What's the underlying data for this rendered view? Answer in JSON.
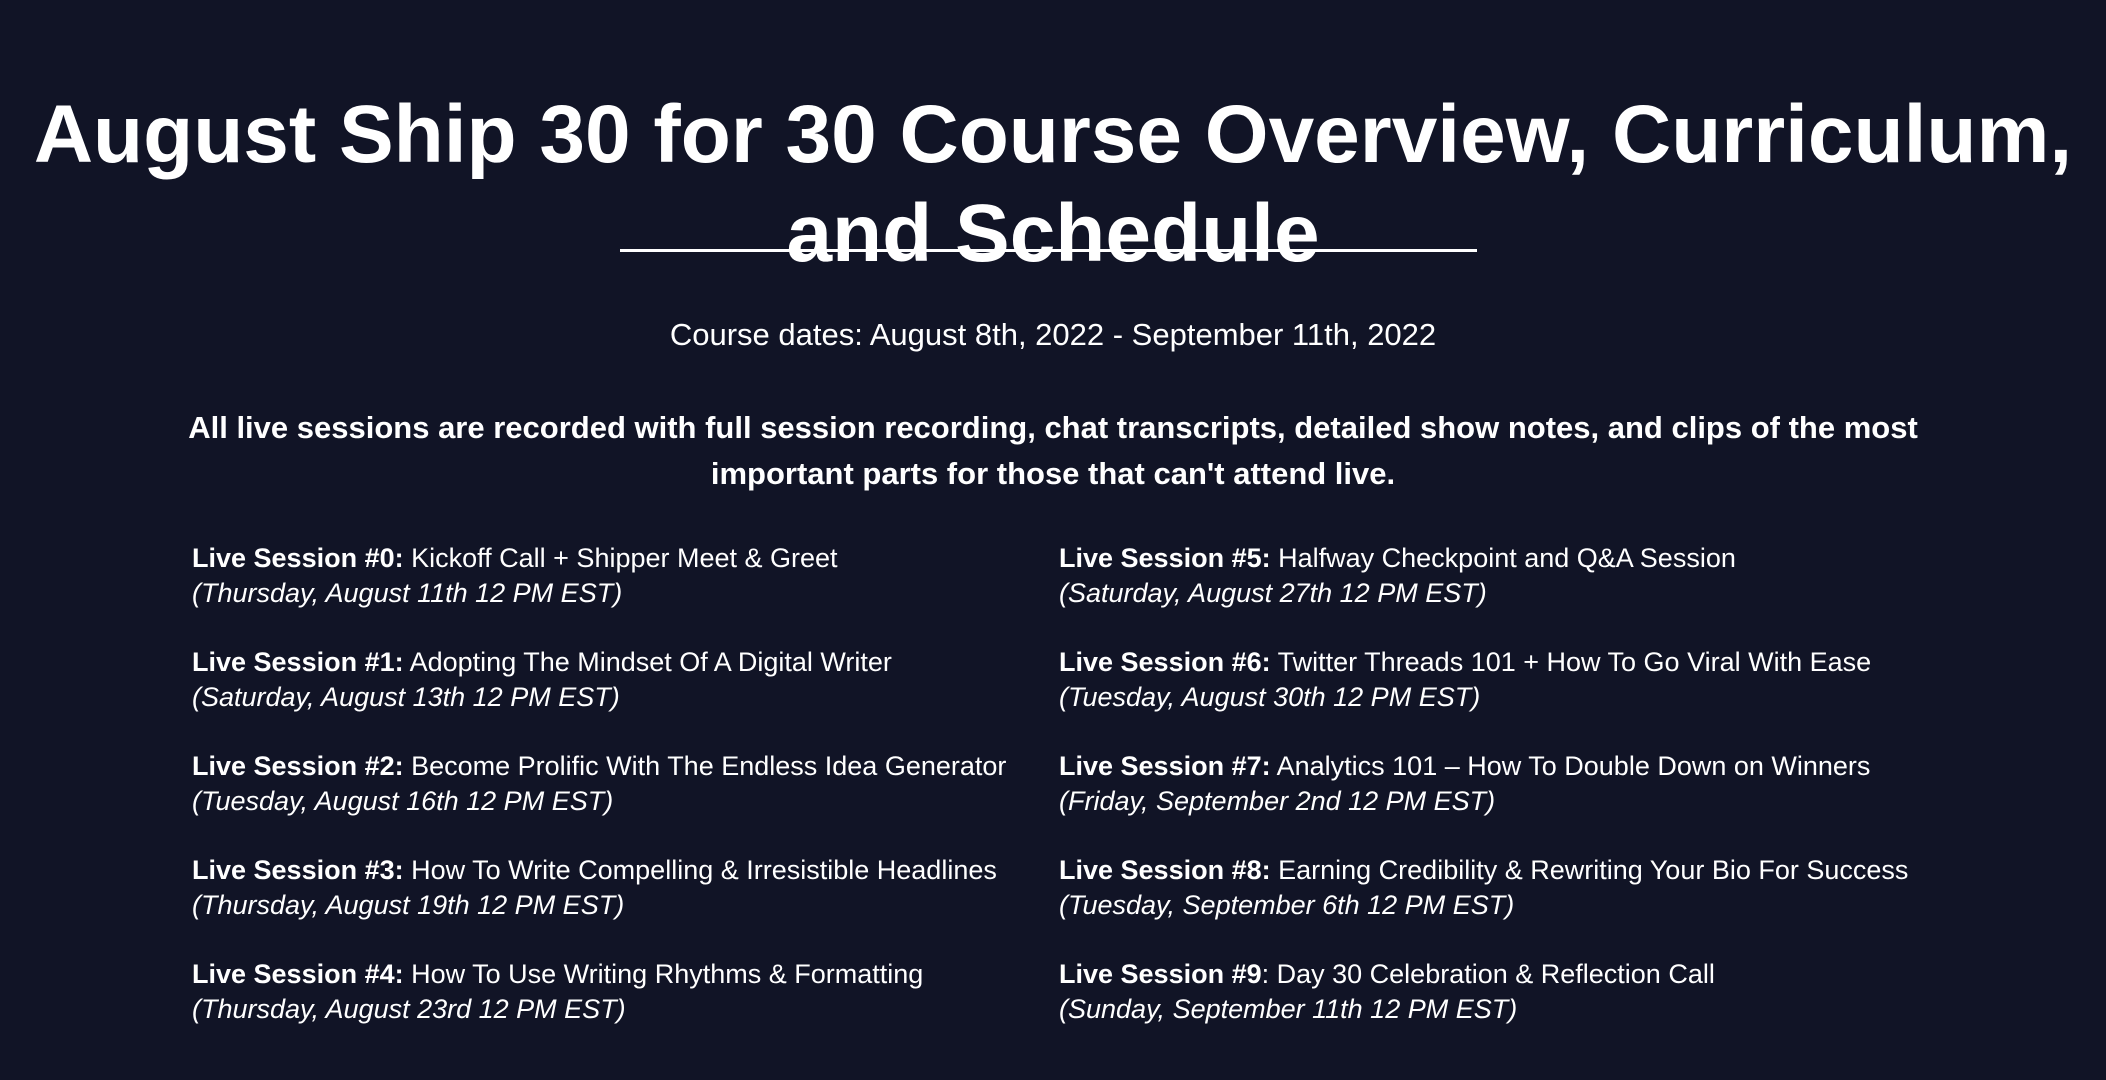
{
  "header": {
    "title_line1": "August Ship 30 for 30 Course Overview, Curriculum,",
    "title_line2": "and Schedule"
  },
  "course_dates": "Course dates: August 8th, 2022 - September 11th, 2022",
  "notice": {
    "line1": "All live sessions are recorded with full session recording, chat transcripts, detailed show notes, and clips of the most",
    "line2": "important parts for those that can't attend live."
  },
  "sessions_left": [
    {
      "label": "Live Session #0:",
      "topic": " Kickoff Call + Shipper Meet & Greet",
      "when": "(Thursday, August 11th 12 PM EST)"
    },
    {
      "label": "Live Session #1:",
      "topic": " Adopting The Mindset Of A Digital Writer",
      "when": "(Saturday, August 13th 12 PM EST)"
    },
    {
      "label": "Live Session #2:",
      "topic": " Become Prolific With The Endless Idea Generator",
      "when": "(Tuesday, August 16th 12 PM EST)"
    },
    {
      "label": "Live Session #3:",
      "topic": " How To Write Compelling & Irresistible Headlines",
      "when": "(Thursday, August 19th 12 PM EST)"
    },
    {
      "label": "Live Session #4:",
      "topic": " How To Use Writing Rhythms & Formatting",
      "when": "(Thursday, August 23rd 12 PM EST)"
    }
  ],
  "sessions_right": [
    {
      "label": "Live Session #5:",
      "topic": " Halfway Checkpoint and Q&A Session",
      "when": "(Saturday, August 27th 12 PM EST)"
    },
    {
      "label": "Live Session #6:",
      "topic": " Twitter Threads 101 + How To Go Viral With Ease",
      "when": "(Tuesday, August 30th 12 PM EST)"
    },
    {
      "label": "Live Session #7:",
      "topic": " Analytics 101 – How To Double Down on Winners",
      "when": "(Friday, September 2nd 12 PM EST)"
    },
    {
      "label": "Live Session #8:",
      "topic": " Earning Credibility & Rewriting Your Bio For Success",
      "when": "(Tuesday, September 6th 12 PM EST)"
    },
    {
      "label": "Live Session #9",
      "topic": ": Day 30 Celebration & Reflection Call",
      "when": "(Sunday, September 11th 12 PM EST)"
    }
  ]
}
